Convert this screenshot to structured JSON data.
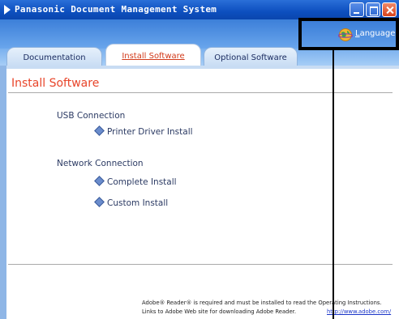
{
  "window": {
    "title": "Panasonic Document Management System"
  },
  "header": {
    "language_label": "Language",
    "language_icon": "globe-icon"
  },
  "tabs": [
    {
      "label": "Documentation",
      "active": false
    },
    {
      "label": "Install Software",
      "active": true
    },
    {
      "label": "Optional Software",
      "active": false
    }
  ],
  "main": {
    "section_title": "Install Software",
    "usb": {
      "group_label": "USB Connection",
      "links": [
        "Printer Driver Install"
      ]
    },
    "network": {
      "group_label": "Network Connection",
      "links": [
        "Complete Install",
        "Custom Install"
      ]
    }
  },
  "footer": {
    "line1": "Adobe® Reader® is required and must be installed to read the Operating Instructions.",
    "line2": "Links to Adobe Web site for downloading Adobe Reader.",
    "link": "http://www.adobe.com/"
  },
  "colors": {
    "titlebar": "#0d4fbf",
    "accent_red": "#e8452a",
    "header_blue": "#3c7fd9",
    "text_navy": "#2b3a63"
  }
}
